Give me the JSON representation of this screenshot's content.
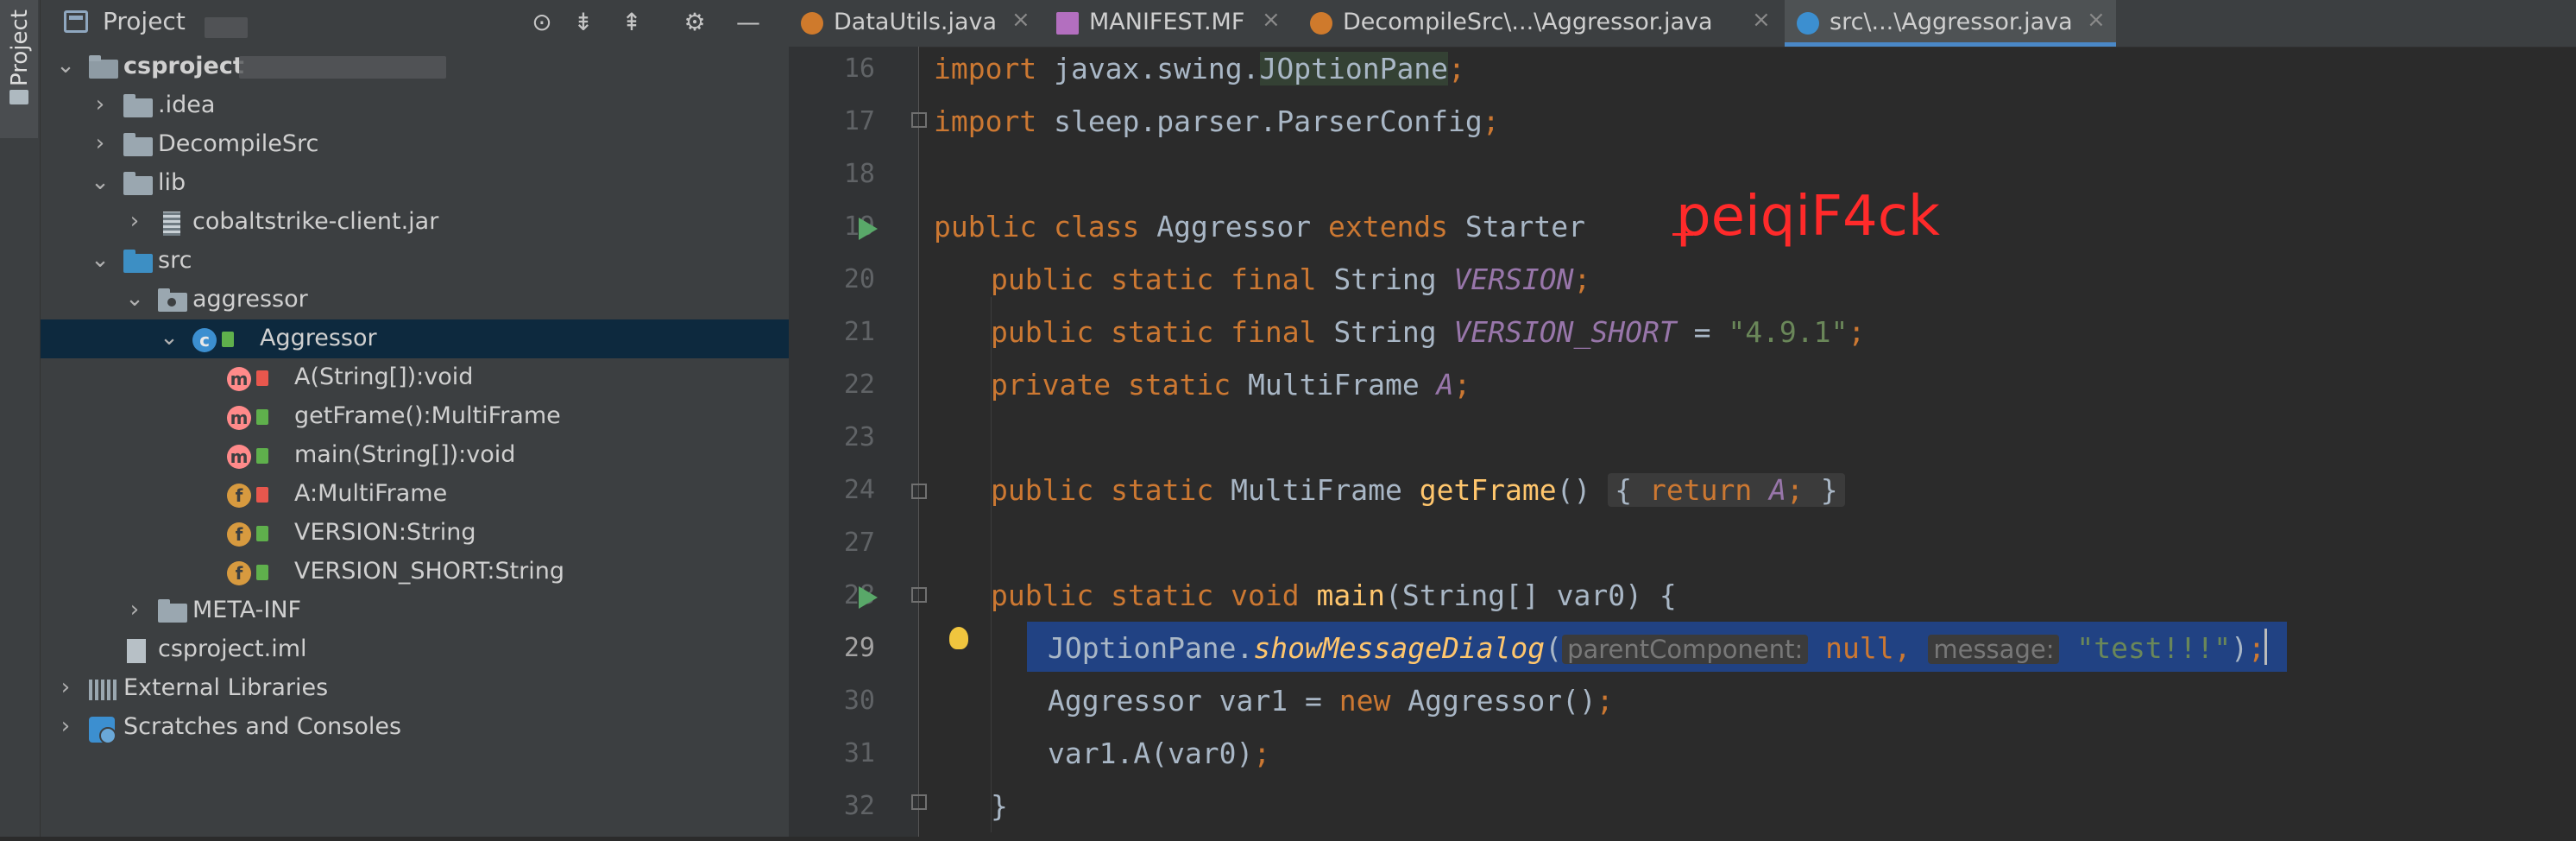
{
  "sidebar_strip": {
    "label": "Project"
  },
  "project_panel": {
    "title": "Project",
    "header_buttons": [
      "target-icon",
      "expand-all-icon",
      "collapse-all-icon",
      "gear-icon",
      "minimize-icon"
    ],
    "tree": [
      {
        "label": "csproject",
        "depth": 0,
        "expanded": true,
        "icon": "folder-icon",
        "bold": true
      },
      {
        "label": ".idea",
        "depth": 1,
        "expanded": false,
        "icon": "folder-icon"
      },
      {
        "label": "DecompileSrc",
        "depth": 1,
        "expanded": false,
        "icon": "folder-icon"
      },
      {
        "label": "lib",
        "depth": 1,
        "expanded": true,
        "icon": "folder-icon"
      },
      {
        "label": "cobaltstrike-client.jar",
        "depth": 2,
        "expanded": false,
        "icon": "jar-icon"
      },
      {
        "label": "src",
        "depth": 1,
        "expanded": true,
        "icon": "source-folder-icon"
      },
      {
        "label": "aggressor",
        "depth": 2,
        "expanded": true,
        "icon": "package-icon"
      },
      {
        "label": "Aggressor",
        "depth": 3,
        "expanded": true,
        "icon": "class-icon",
        "selected": true
      },
      {
        "label": "A(String[]):void",
        "depth": 4,
        "icon": "method-icon",
        "access": "private"
      },
      {
        "label": "getFrame():MultiFrame",
        "depth": 4,
        "icon": "method-icon",
        "access": "public"
      },
      {
        "label": "main(String[]):void",
        "depth": 4,
        "icon": "method-icon",
        "access": "public"
      },
      {
        "label": "A:MultiFrame",
        "depth": 4,
        "icon": "field-icon",
        "access": "private"
      },
      {
        "label": "VERSION:String",
        "depth": 4,
        "icon": "field-icon",
        "access": "public"
      },
      {
        "label": "VERSION_SHORT:String",
        "depth": 4,
        "icon": "field-icon",
        "access": "public"
      },
      {
        "label": "META-INF",
        "depth": 2,
        "expanded": false,
        "icon": "folder-icon"
      },
      {
        "label": "csproject.iml",
        "depth": 1,
        "icon": "iml-file-icon"
      },
      {
        "label": "External Libraries",
        "depth": 0,
        "expanded": false,
        "icon": "library-icon"
      },
      {
        "label": "Scratches and Consoles",
        "depth": 0,
        "expanded": false,
        "icon": "scratches-icon"
      }
    ]
  },
  "tabs": [
    {
      "label": "DataUtils.java",
      "icon": "java-file-icon",
      "active": false
    },
    {
      "label": "MANIFEST.MF",
      "icon": "manifest-file-icon",
      "active": false
    },
    {
      "label": "DecompileSrc\\...\\Aggressor.java",
      "icon": "java-file-icon",
      "active": false
    },
    {
      "label": "src\\...\\Aggressor.java",
      "icon": "class-file-icon",
      "active": true
    }
  ],
  "tab_close_glyph": "×",
  "editor": {
    "current_line": "29",
    "line_numbers": [
      "16",
      "17",
      "18",
      "19",
      "20",
      "21",
      "22",
      "23",
      "24",
      "27",
      "28",
      "29",
      "30",
      "31",
      "32"
    ],
    "annotation": "peiqiF4ck",
    "code": {
      "l16": {
        "kw": "import ",
        "pkg": "javax.swing.",
        "cls": "JOptionPane",
        "end": ";"
      },
      "l17": {
        "kw": "import ",
        "pkg": "sleep.parser.ParserConfig",
        "end": ";"
      },
      "l19": {
        "kw1": "public class ",
        "name": "Aggressor ",
        "kw2": "extends ",
        "parent": "Starter "
      },
      "l20": {
        "kw": "public static final ",
        "type": "String ",
        "field": "VERSION",
        "end": ";"
      },
      "l21": {
        "kw": "public static final ",
        "type": "String ",
        "field": "VERSION_SHORT",
        "eq": " = ",
        "value": "\"4.9.1\"",
        "end": ";"
      },
      "l22": {
        "kw": "private static ",
        "type": "MultiFrame ",
        "field": "A",
        "end": ";"
      },
      "l24": {
        "kw": "public static ",
        "type": "MultiFrame ",
        "fn": "getFrame",
        "parens": "() ",
        "ob": "{ ",
        "ret": "return ",
        "field": "A",
        "semi": "; ",
        "cb": "}"
      },
      "l28": {
        "kw": "public static void ",
        "fn": "main",
        "args": "(String[] var0) {"
      },
      "l29": {
        "obj": "JOptionPane.",
        "fn": "showMessageDialog",
        "open": "(",
        "hint1": "parentComponent:",
        "nul": " null",
        "comma": ", ",
        "hint2": "message:",
        "str": " \"test!!!\"",
        "close": ")",
        "end": ";"
      },
      "l30": {
        "type": "Aggressor var1 = ",
        "kw": "new ",
        "ctor": "Aggressor()",
        "end": ";"
      },
      "l31": {
        "call": "var1.A(var0)",
        "end": ";"
      },
      "l32": {
        "brace": "}"
      }
    }
  }
}
